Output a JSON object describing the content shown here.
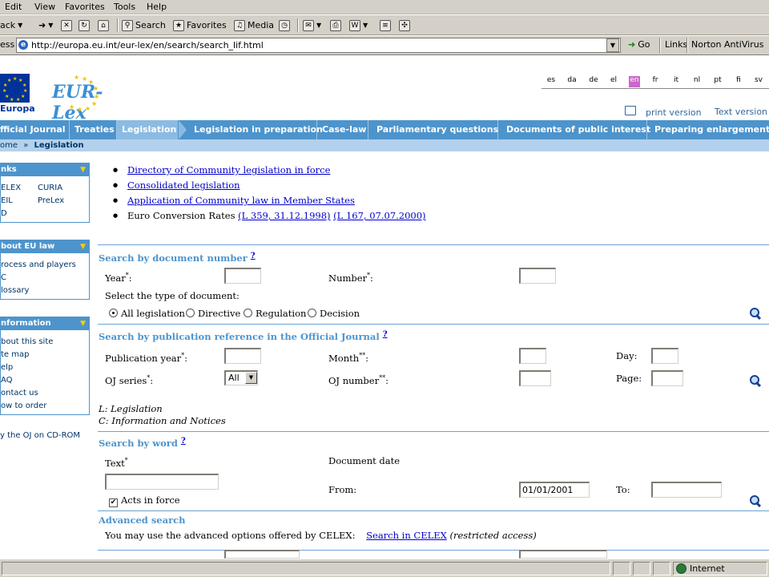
{
  "browser": {
    "menu": [
      "Edit",
      "View",
      "Favorites",
      "Tools",
      "Help"
    ],
    "toolbar": {
      "back": "ack",
      "search": "Search",
      "favorites": "Favorites",
      "media": "Media"
    },
    "address_label": "ess",
    "address_url": "http://europa.eu.int/eur-lex/en/search/search_lif.html",
    "go_label": "Go",
    "links_label": "Links",
    "norton_label": "Norton AntiVirus",
    "status_zone": "Internet"
  },
  "header": {
    "europa_label": "Europa",
    "eurlex_logo": "EUR-Lex",
    "languages": [
      "es",
      "da",
      "de",
      "el",
      "en",
      "fr",
      "it",
      "nl",
      "pt",
      "fi",
      "sv"
    ],
    "active_language": "en",
    "print_version": "print version",
    "text_version": "Text version"
  },
  "nav": {
    "items": [
      "fficial Journal",
      "Treaties",
      "Legislation",
      "Legislation in preparation",
      "Case-law",
      "Parliamentary questions",
      "Documents of public interest",
      "Preparing enlargement"
    ],
    "active": "Legislation",
    "breadcrumb_home": "ome",
    "breadcrumb_sep": "»",
    "breadcrumb_current": "Legislation"
  },
  "sidebar": {
    "links_title": "nks",
    "links_col1": [
      "ELEX",
      "EIL",
      "D"
    ],
    "links_col2": [
      "CURIA",
      "PreLex"
    ],
    "about_title": "bout EU law",
    "about_items": [
      "rocess and players",
      "C",
      "lossary"
    ],
    "info_title": "nformation",
    "info_items": [
      "bout this site",
      "te map",
      "elp",
      "AQ",
      "ontact us",
      "ow to order"
    ],
    "cdrom": "y the OJ on CD-ROM"
  },
  "main": {
    "links": [
      "Directory of Community legislation in force",
      "Consolidated legislation",
      "Application of Community law in Member States"
    ],
    "euro_rates_label": "Euro Conversion Rates",
    "euro_rate_link1": "(L 359, 31.12.1998)",
    "euro_rate_link2": "(L 167, 07.07.2000)",
    "doc_number": {
      "title": "Search by document number",
      "help": "?",
      "year_label": "Year",
      "number_label": "Number",
      "type_prompt": "Select the type of document:",
      "types": [
        "All legislation",
        "Directive",
        "Regulation",
        "Decision"
      ],
      "selected_type": "All legislation"
    },
    "pub_ref": {
      "title": "Search by publication reference in the Official Journal",
      "help": "?",
      "pub_year_label": "Publication year",
      "month_label": "Month",
      "day_label": "Day:",
      "oj_series_label": "OJ series",
      "oj_series_value": "All",
      "oj_number_label": "OJ number",
      "page_label": "Page:",
      "note_l": "L: Legislation",
      "note_c": "C: Information and Notices"
    },
    "by_word": {
      "title": "Search by word",
      "help": "?",
      "text_label": "Text",
      "doc_date_label": "Document date",
      "from_label": "From:",
      "from_value": "01/01/2001",
      "to_label": "To:",
      "acts_in_force_label": "Acts in force",
      "acts_in_force_checked": "✔"
    },
    "advanced": {
      "title": "Advanced search",
      "text": "You may use the advanced options offered by CELEX:",
      "link": "Search in CELEX",
      "restricted": "(restricted access)"
    }
  }
}
